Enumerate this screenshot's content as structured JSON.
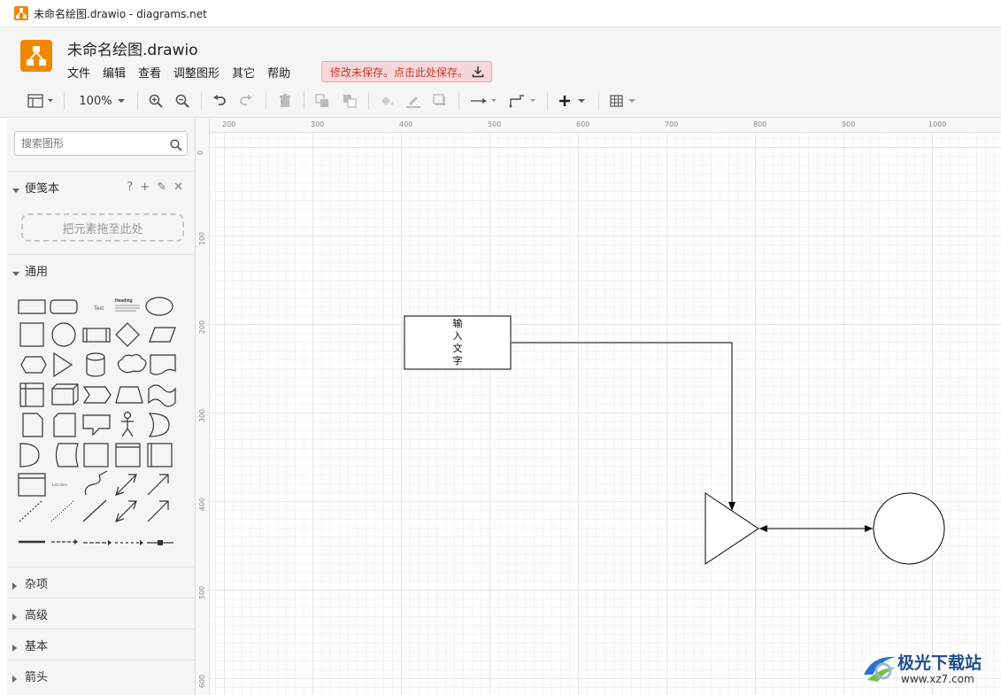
{
  "window": {
    "title": "未命名绘图.drawio - diagrams.net"
  },
  "app": {
    "doc_title": "未命名绘图.drawio",
    "menu": [
      "文件",
      "编辑",
      "查看",
      "调整图形",
      "其它",
      "帮助"
    ],
    "save_notice": "修改未保存。点击此处保存。"
  },
  "toolbar": {
    "zoom": "100%"
  },
  "sidebar": {
    "search_placeholder": "搜索图形",
    "scratchpad": {
      "title": "便笺本",
      "tools": [
        "?",
        "+",
        "✎",
        "✕"
      ],
      "dropzone": "把元素拖至此处"
    },
    "general": {
      "title": "通用"
    },
    "sections": [
      "杂项",
      "高级",
      "基本",
      "箭头"
    ],
    "shape_text_labels": {
      "text": "Text",
      "heading": "Heading",
      "list": "List Item"
    }
  },
  "rulers": {
    "top": [
      "200",
      "300",
      "400",
      "500",
      "600",
      "700",
      "800",
      "900",
      "1000"
    ],
    "left": [
      "0",
      "100",
      "200",
      "300",
      "400",
      "500",
      "600"
    ]
  },
  "diagram": {
    "rect_text": [
      "输",
      "入",
      "文",
      "字"
    ]
  },
  "watermark": {
    "name": "极光下载站",
    "url": "www.xz7.com"
  }
}
